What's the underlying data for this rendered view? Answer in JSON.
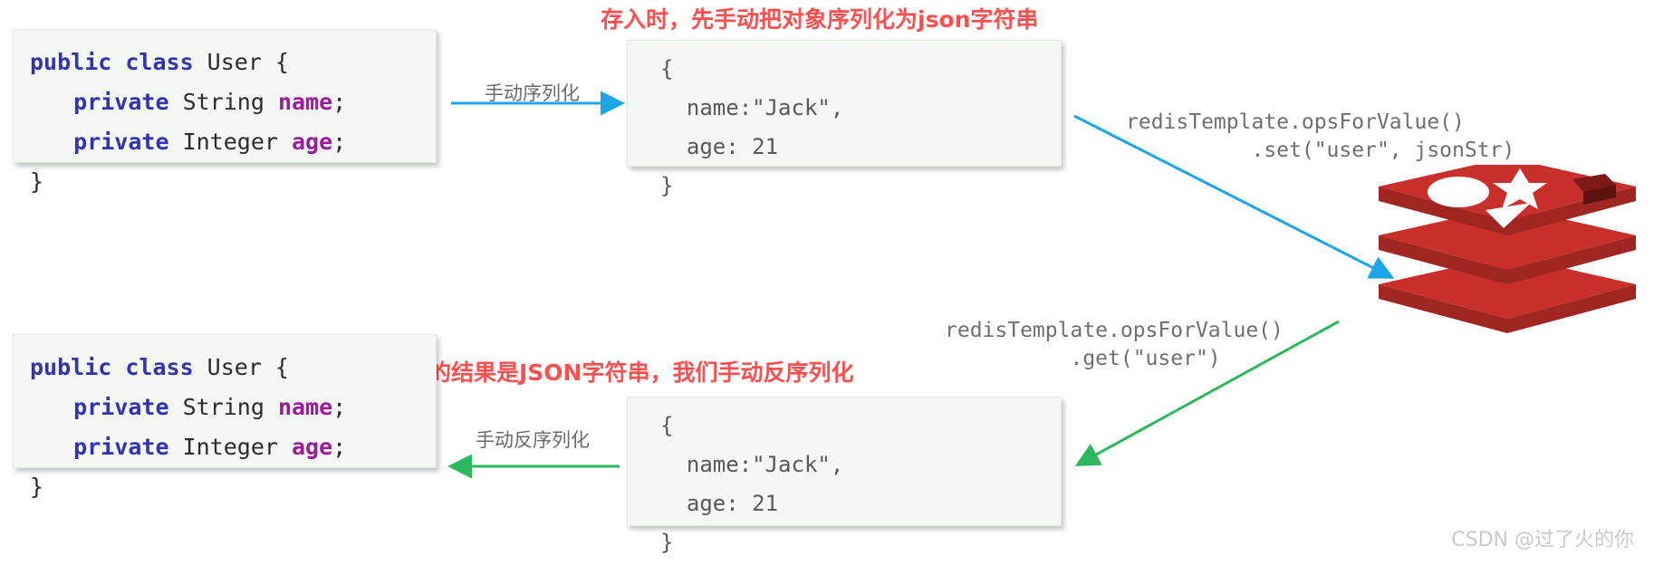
{
  "diagram": {
    "title_note_store": "存入时，先手动把对象序列化为json字符串",
    "title_note_read": "读取的结果是JSON字符串，我们手动反序列化",
    "watermark": "CSDN @过了火的你"
  },
  "java_class_top": {
    "line1_kw": "public class",
    "line1_rest": " User {",
    "line2_kw": "private",
    "line2_type": " String ",
    "line2_field": "name",
    "line2_tail": ";",
    "line3_kw": "private",
    "line3_type": " Integer ",
    "line3_field": "age",
    "line3_tail": ";",
    "line4": "}"
  },
  "java_class_bottom": {
    "line1_kw": "public class",
    "line1_rest": " User {",
    "line2_kw": "private",
    "line2_type": " String ",
    "line2_field": "name",
    "line2_tail": ";",
    "line3_kw": "private",
    "line3_type": " Integer ",
    "line3_field": "age",
    "line3_tail": ";",
    "line4": "}"
  },
  "json_top": {
    "text": "{\n  name:\"Jack\",\n  age: 21\n}"
  },
  "json_bottom": {
    "text": "{\n  name:\"Jack\",\n  age: 21\n}"
  },
  "arrows": {
    "serialize_label": "手动序列化",
    "deserialize_label": "手动反序列化",
    "set_call": "redisTemplate.opsForValue()\n          .set(\"user\", jsonStr)",
    "get_call": "redisTemplate.opsForValue()\n          .get(\"user\")"
  },
  "colors": {
    "note_red": "#fc4f4f",
    "arrow_blue": "#1ba6e8",
    "arrow_green": "#2cb85c",
    "keyword_blue": "#3333b2",
    "field_purple": "#9a1c9a",
    "code_bg": "#f4f8f2",
    "redis_red": "#c9302c",
    "redis_dark": "#a02622"
  },
  "icons": {
    "redis": "redis-logo"
  }
}
